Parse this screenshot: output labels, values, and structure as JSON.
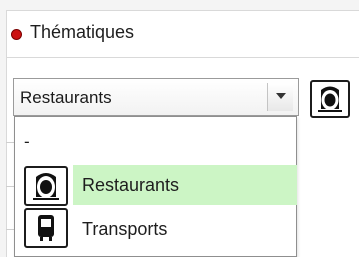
{
  "section": {
    "title": "Thématiques",
    "status_color": "#cc1111"
  },
  "select": {
    "value": "Restaurants",
    "icon": "cloche-icon"
  },
  "dropdown": {
    "options": [
      {
        "label": "-",
        "icon": ""
      },
      {
        "label": "Restaurants",
        "icon": "cloche-icon",
        "highlighted": true,
        "highlight_color": "#ccf5c5"
      },
      {
        "label": "Transports",
        "icon": "bus-icon"
      }
    ]
  }
}
